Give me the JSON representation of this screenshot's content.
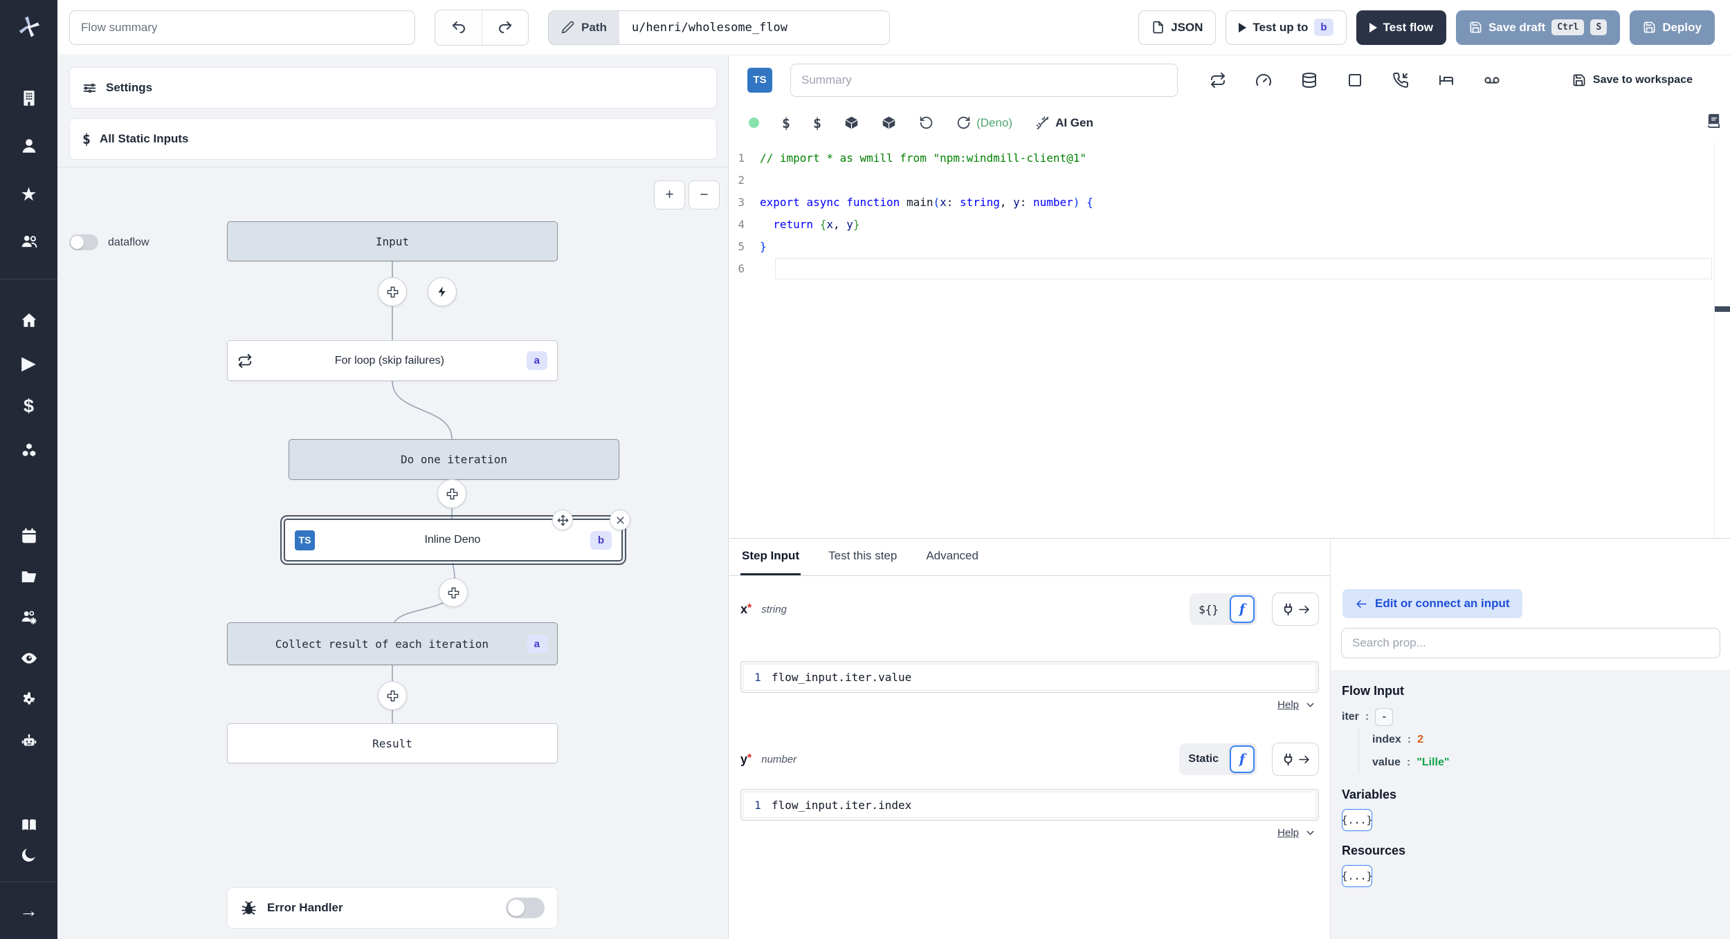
{
  "topbar": {
    "flow_summary_placeholder": "Flow summary",
    "path_label": "Path",
    "path_value": "u/henri/wholesome_flow",
    "json_label": "JSON",
    "test_up_to_label": "Test up to",
    "test_up_to_badge": "b",
    "test_flow_label": "Test flow",
    "save_draft_label": "Save draft",
    "kbd_ctrl": "Ctrl",
    "kbd_s": "S",
    "deploy_label": "Deploy"
  },
  "left_panel": {
    "settings_label": "Settings",
    "all_static_inputs_label": "All Static Inputs",
    "dataflow_label": "dataflow",
    "zoom_in": "+",
    "zoom_out": "−",
    "error_handler_label": "Error Handler"
  },
  "graph": {
    "input_label": "Input",
    "for_loop_label": "For loop (skip failures)",
    "for_loop_badge": "a",
    "do_one_iteration_label": "Do one iteration",
    "inline_deno_lang": "TS",
    "inline_deno_label": "Inline Deno",
    "inline_deno_badge": "b",
    "collect_label": "Collect result of each iteration",
    "collect_badge": "a",
    "result_label": "Result"
  },
  "editor": {
    "lang_badge": "TS",
    "summary_placeholder": "Summary",
    "save_to_workspace_label": "Save to workspace",
    "runtime_label": "(Deno)",
    "ai_gen_label": "AI Gen",
    "code_lines": [
      {
        "tokens": [
          [
            "cm",
            "// import * as wmill from \"npm:windmill-client@1\""
          ]
        ]
      },
      {
        "tokens": []
      },
      {
        "tokens": [
          [
            "kw",
            "export"
          ],
          [
            "pl",
            " "
          ],
          [
            "kw",
            "async"
          ],
          [
            "pl",
            " "
          ],
          [
            "kw",
            "function"
          ],
          [
            "pl",
            " "
          ],
          [
            "fn",
            "main"
          ],
          [
            "p1",
            "("
          ],
          [
            "pr",
            "x"
          ],
          [
            "pl",
            ": "
          ],
          [
            "ty",
            "string"
          ],
          [
            "pl",
            ", "
          ],
          [
            "pr",
            "y"
          ],
          [
            "pl",
            ": "
          ],
          [
            "ty",
            "number"
          ],
          [
            "p1",
            ")"
          ],
          [
            "pl",
            " "
          ],
          [
            "p1",
            "{"
          ]
        ]
      },
      {
        "tokens": [
          [
            "pl",
            "  "
          ],
          [
            "kw",
            "return"
          ],
          [
            "pl",
            " "
          ],
          [
            "p2",
            "{"
          ],
          [
            "pr",
            "x"
          ],
          [
            "pl",
            ", "
          ],
          [
            "pr",
            "y"
          ],
          [
            "p2",
            "}"
          ]
        ]
      },
      {
        "tokens": [
          [
            "p1",
            "}"
          ]
        ]
      },
      {
        "tokens": [],
        "current": true
      }
    ]
  },
  "step_panel": {
    "tabs": [
      {
        "label": "Step Input"
      },
      {
        "label": "Test this step"
      },
      {
        "label": "Advanced"
      }
    ],
    "x": {
      "name": "x",
      "required": "*",
      "type": "string",
      "toggle_left": "${}",
      "toggle_right": "f",
      "line_no": "1",
      "code": "flow_input.iter.value",
      "help": "Help"
    },
    "y": {
      "name": "y",
      "required": "*",
      "type": "number",
      "toggle_left": "Static",
      "toggle_right": "f",
      "line_no": "1",
      "code": "flow_input.iter.index",
      "help": "Help"
    }
  },
  "prop_panel": {
    "edit_connect_label": "Edit or connect an input",
    "search_placeholder": "Search prop...",
    "flow_input_title": "Flow Input",
    "tree": [
      {
        "key": "iter",
        "colon": ":",
        "value": "-",
        "vclass": "collapse",
        "indent": 0
      },
      {
        "key": "index",
        "colon": ":",
        "value": "2",
        "vclass": "orange",
        "indent": 1
      },
      {
        "key": "value",
        "colon": ":",
        "value": "\"Lille\"",
        "vclass": "green",
        "indent": 1
      }
    ],
    "variables_title": "Variables",
    "variables_button": "{...}",
    "resources_title": "Resources",
    "resources_button": "{...}"
  },
  "colors": {
    "sidebar_bg": "#232936",
    "steel_button": "#7b95b7",
    "dark_button": "#2b3346",
    "badge_bg": "#dfe4fc",
    "badge_text": "#4338ca",
    "ts_blue": "#3276c3",
    "link_blue": "#1d4ed8",
    "value_green": "#16a34a",
    "value_orange": "#e05d12",
    "status_green": "#86e3ac"
  }
}
